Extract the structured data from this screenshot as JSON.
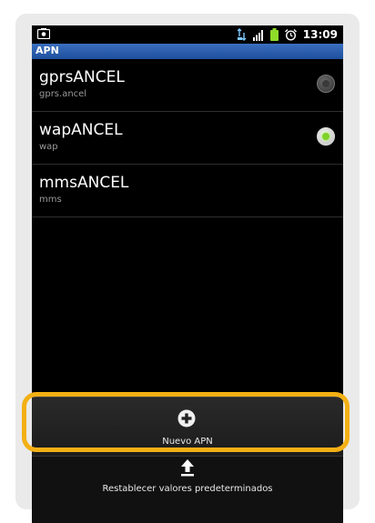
{
  "status_bar": {
    "time": "13:09"
  },
  "title_bar": {
    "title": "APN"
  },
  "apns": [
    {
      "name": "gprsANCEL",
      "apn": "gprs.ancel",
      "selected": false
    },
    {
      "name": "wapANCEL",
      "apn": "wap",
      "selected": true
    },
    {
      "name": "mmsANCEL",
      "apn": "mms",
      "selected": null
    }
  ],
  "menu": {
    "new_apn_label": "Nuevo APN",
    "reset_label": "Restablecer valores predeterminados"
  },
  "colors": {
    "title_bar": "#2a5fae",
    "selected_radio": "#7fd22a",
    "highlight_outline": "#f3b015"
  }
}
